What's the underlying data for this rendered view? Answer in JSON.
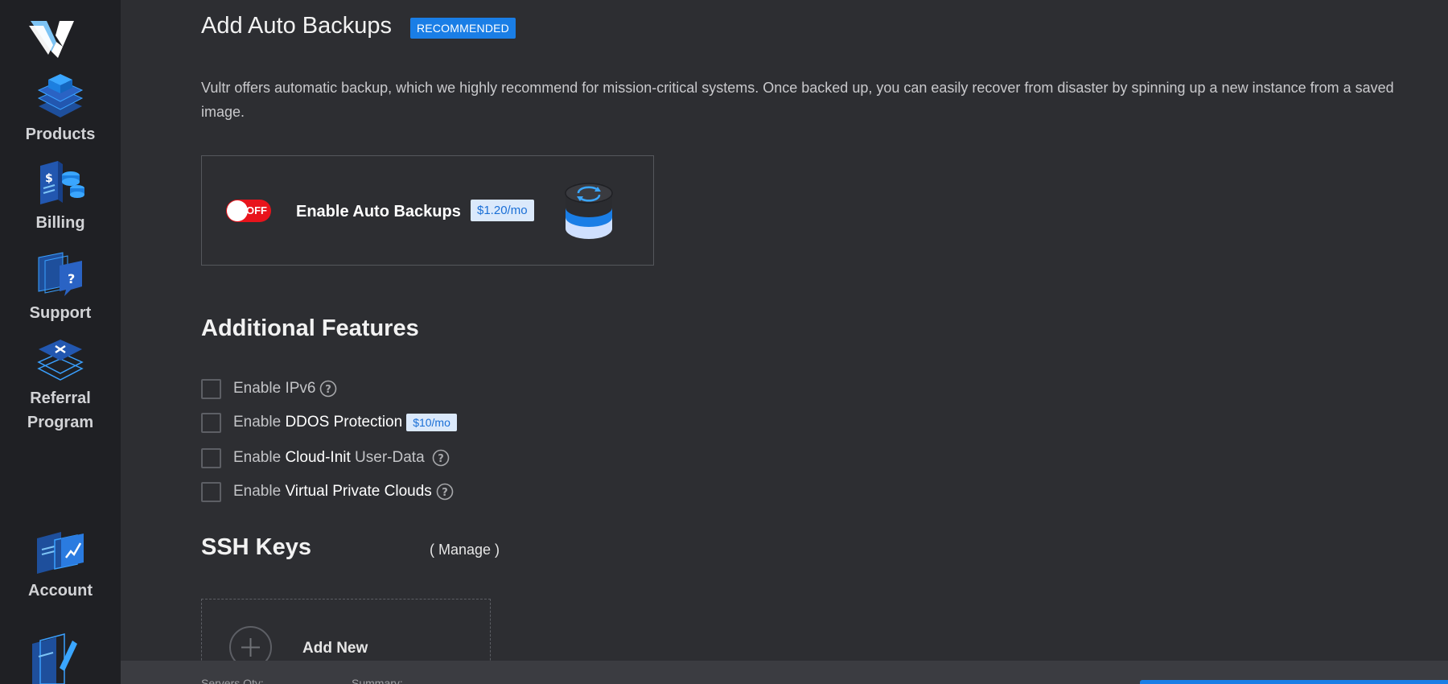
{
  "sidebar": {
    "items": [
      {
        "label": "Products",
        "icon": "products-icon"
      },
      {
        "label": "Billing",
        "icon": "billing-icon"
      },
      {
        "label": "Support",
        "icon": "support-icon"
      },
      {
        "label": "Referral",
        "label2": "Program",
        "icon": "referral-icon"
      },
      {
        "label": "Account",
        "icon": "account-icon"
      }
    ]
  },
  "backups": {
    "title": "Add Auto Backups",
    "badge": "RECOMMENDED",
    "description": "Vultr offers automatic backup, which we highly recommend for mission-critical systems. Once backed up, you can easily recover from disaster by spinning up a new instance from a saved image.",
    "toggle_state": "OFF",
    "label": "Enable Auto Backups",
    "price": "$1.20/mo"
  },
  "features": {
    "title": "Additional Features",
    "items": [
      {
        "prefix": "Enable ",
        "name": "IPv6",
        "suffix": "",
        "help": true
      },
      {
        "prefix": "Enable ",
        "name": "DDOS Protection",
        "suffix": "",
        "price": "$10/mo"
      },
      {
        "prefix": "Enable ",
        "name": "Cloud-Init",
        "suffix": " User-Data",
        "help": true
      },
      {
        "prefix": "Enable ",
        "name": "Virtual Private Clouds",
        "suffix": "",
        "help": true
      }
    ]
  },
  "ssh": {
    "title": "SSH Keys",
    "manage": "( Manage )",
    "add_label": "Add New"
  },
  "bottom": {
    "servers_qty": "Servers Qty:",
    "summary": "Summary:"
  },
  "colors": {
    "accent": "#1a7ee6",
    "toggle_off": "#e8141c",
    "background": "#2d2e32",
    "sidebar": "#1f2024"
  }
}
